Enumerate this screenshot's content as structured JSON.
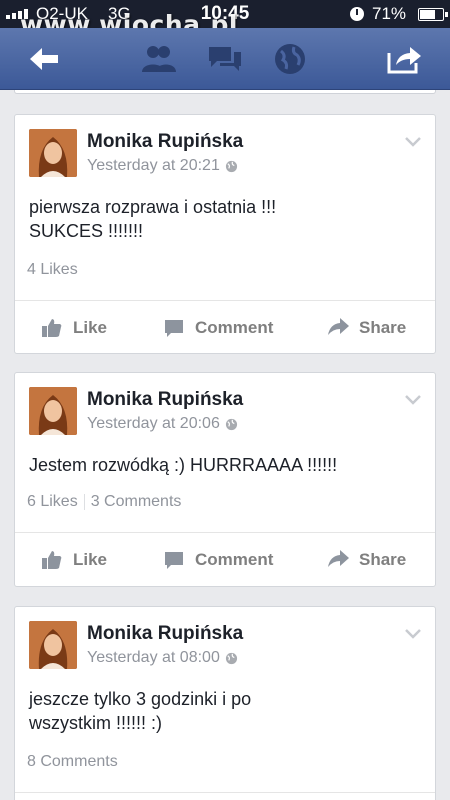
{
  "statusbar": {
    "carrier": "O2-UK",
    "network": "3G",
    "time": "10:45",
    "battery": "71%",
    "battery_level": 0.71
  },
  "watermark": "www.wiocha.pl",
  "navbar": {
    "back_icon": "back-arrow-icon",
    "friends_icon": "friend-requests-icon",
    "messages_icon": "messages-icon",
    "notifications_icon": "globe-notifications-icon",
    "share_icon": "share-icon",
    "color": "#3c5998"
  },
  "posts": [
    {
      "author": "Monika Rupińska",
      "time": "Yesterday at 20:21",
      "text": "pierwsza rozprawa i ostatnia !!!\nSUKCES !!!!!!!",
      "likes": "4 Likes",
      "comments": ""
    },
    {
      "author": "Monika Rupińska",
      "time": "Yesterday at 20:06",
      "text": "Jestem rozwódką :) HURRRAAAA !!!!!!",
      "likes": "6 Likes",
      "comments": "3 Comments"
    },
    {
      "author": "Monika Rupińska",
      "time": "Yesterday at 08:00",
      "text": "jeszcze tylko 3 godzinki i po\nwszystkim !!!!!! :)",
      "likes": "",
      "comments": "8 Comments"
    }
  ],
  "actions": {
    "like": "Like",
    "comment": "Comment",
    "share": "Share"
  }
}
